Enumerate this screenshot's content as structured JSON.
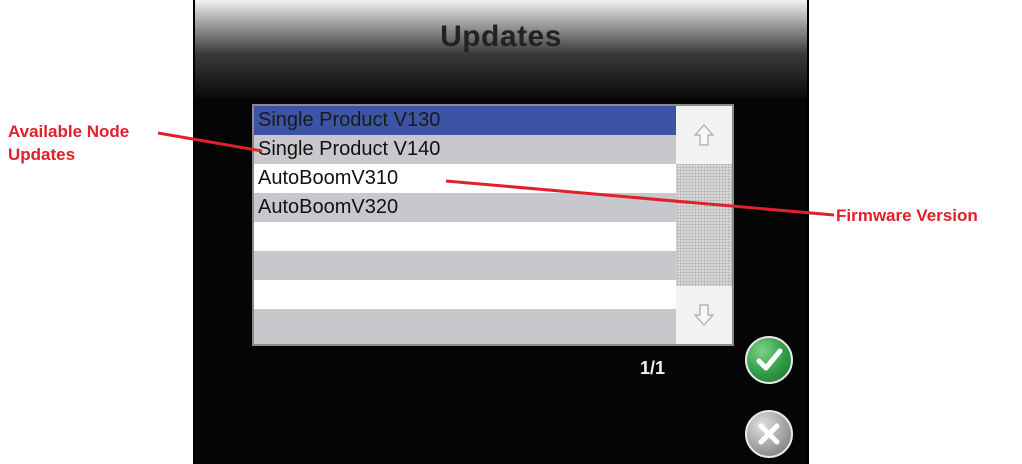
{
  "title": "Updates",
  "list": {
    "rows": [
      {
        "label": "Single Product V130",
        "style": "selected"
      },
      {
        "label": "Single Product V140",
        "style": "gray"
      },
      {
        "label": "AutoBoomV310",
        "style": "white"
      },
      {
        "label": "AutoBoomV320",
        "style": "gray"
      },
      {
        "label": "",
        "style": "white"
      },
      {
        "label": "",
        "style": "gray"
      },
      {
        "label": "",
        "style": "white"
      },
      {
        "label": "",
        "style": "gray"
      }
    ]
  },
  "scrollbar": {
    "up_icon": "arrow-up-icon",
    "down_icon": "arrow-down-icon"
  },
  "page_indicator": "1/1",
  "buttons": {
    "accept_icon": "checkmark-icon",
    "cancel_icon": "x-icon"
  },
  "callouts": {
    "left_line1": "Available Node",
    "left_line2": "Updates",
    "right": "Firmware Version",
    "color": "#e0202a"
  },
  "colors": {
    "selected_row": "#3b54a3",
    "gray_row": "#c8c8cc",
    "accept": "#2e9a45"
  }
}
